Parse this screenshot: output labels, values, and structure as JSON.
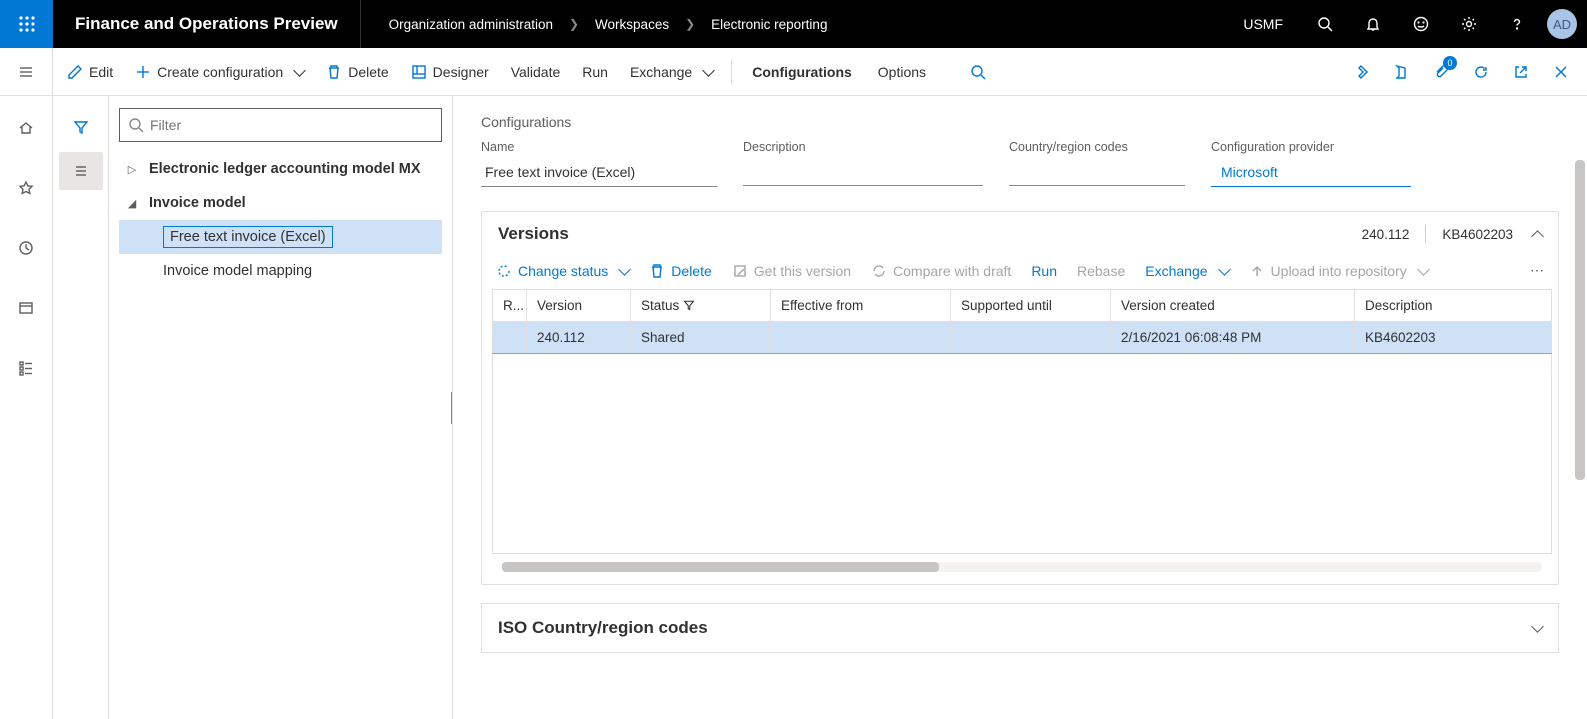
{
  "app_title": "Finance and Operations Preview",
  "breadcrumb": [
    "Organization administration",
    "Workspaces",
    "Electronic reporting"
  ],
  "company": "USMF",
  "avatar": "AD",
  "notif_badge": "0",
  "actionbar": {
    "edit": "Edit",
    "create": "Create configuration",
    "delete": "Delete",
    "designer": "Designer",
    "validate": "Validate",
    "run": "Run",
    "exchange": "Exchange",
    "tabs": {
      "configurations": "Configurations",
      "options": "Options"
    }
  },
  "tree": {
    "filter_placeholder": "Filter",
    "items": [
      {
        "label": "Electronic ledger accounting model MX",
        "expanded": false,
        "bold": true,
        "depth": 0
      },
      {
        "label": "Invoice model",
        "expanded": true,
        "bold": true,
        "depth": 0
      },
      {
        "label": "Free text invoice (Excel)",
        "depth": 1,
        "selected": true
      },
      {
        "label": "Invoice model mapping",
        "depth": 1
      }
    ]
  },
  "detail": {
    "section": "Configurations",
    "fields": {
      "name_label": "Name",
      "name_value": "Free text invoice (Excel)",
      "desc_label": "Description",
      "desc_value": "",
      "codes_label": "Country/region codes",
      "codes_value": "",
      "provider_label": "Configuration provider",
      "provider_value": "Microsoft"
    }
  },
  "versions": {
    "title": "Versions",
    "meta_version": "240.112",
    "meta_kb": "KB4602203",
    "toolbar": {
      "change_status": "Change status",
      "delete": "Delete",
      "get_version": "Get this version",
      "compare": "Compare with draft",
      "run": "Run",
      "rebase": "Rebase",
      "exchange": "Exchange",
      "upload": "Upload into repository"
    },
    "columns": [
      "R...",
      "Version",
      "Status",
      "Effective from",
      "Supported until",
      "Version created",
      "Description"
    ],
    "rows": [
      {
        "r": "",
        "version": "240.112",
        "status": "Shared",
        "effective": "",
        "supported": "",
        "created": "2/16/2021 06:08:48 PM",
        "description": "KB4602203"
      }
    ]
  },
  "iso_title": "ISO Country/region codes"
}
